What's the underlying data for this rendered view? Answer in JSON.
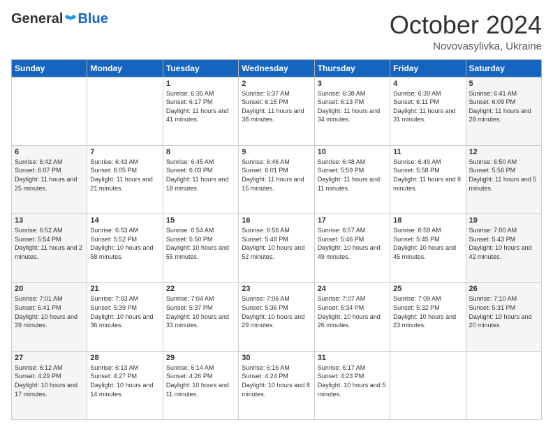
{
  "logo": {
    "general": "General",
    "blue": "Blue"
  },
  "header": {
    "month": "October 2024",
    "location": "Novovasylivka, Ukraine"
  },
  "weekdays": [
    "Sunday",
    "Monday",
    "Tuesday",
    "Wednesday",
    "Thursday",
    "Friday",
    "Saturday"
  ],
  "weeks": [
    [
      {
        "day": "",
        "sunrise": "",
        "sunset": "",
        "daylight": ""
      },
      {
        "day": "",
        "sunrise": "",
        "sunset": "",
        "daylight": ""
      },
      {
        "day": "1",
        "sunrise": "Sunrise: 6:35 AM",
        "sunset": "Sunset: 6:17 PM",
        "daylight": "Daylight: 11 hours and 41 minutes."
      },
      {
        "day": "2",
        "sunrise": "Sunrise: 6:37 AM",
        "sunset": "Sunset: 6:15 PM",
        "daylight": "Daylight: 11 hours and 38 minutes."
      },
      {
        "day": "3",
        "sunrise": "Sunrise: 6:38 AM",
        "sunset": "Sunset: 6:13 PM",
        "daylight": "Daylight: 11 hours and 34 minutes."
      },
      {
        "day": "4",
        "sunrise": "Sunrise: 6:39 AM",
        "sunset": "Sunset: 6:11 PM",
        "daylight": "Daylight: 11 hours and 31 minutes."
      },
      {
        "day": "5",
        "sunrise": "Sunrise: 6:41 AM",
        "sunset": "Sunset: 6:09 PM",
        "daylight": "Daylight: 11 hours and 28 minutes."
      }
    ],
    [
      {
        "day": "6",
        "sunrise": "Sunrise: 6:42 AM",
        "sunset": "Sunset: 6:07 PM",
        "daylight": "Daylight: 11 hours and 25 minutes."
      },
      {
        "day": "7",
        "sunrise": "Sunrise: 6:43 AM",
        "sunset": "Sunset: 6:05 PM",
        "daylight": "Daylight: 11 hours and 21 minutes."
      },
      {
        "day": "8",
        "sunrise": "Sunrise: 6:45 AM",
        "sunset": "Sunset: 6:03 PM",
        "daylight": "Daylight: 11 hours and 18 minutes."
      },
      {
        "day": "9",
        "sunrise": "Sunrise: 6:46 AM",
        "sunset": "Sunset: 6:01 PM",
        "daylight": "Daylight: 11 hours and 15 minutes."
      },
      {
        "day": "10",
        "sunrise": "Sunrise: 6:48 AM",
        "sunset": "Sunset: 5:59 PM",
        "daylight": "Daylight: 11 hours and 11 minutes."
      },
      {
        "day": "11",
        "sunrise": "Sunrise: 6:49 AM",
        "sunset": "Sunset: 5:58 PM",
        "daylight": "Daylight: 11 hours and 8 minutes."
      },
      {
        "day": "12",
        "sunrise": "Sunrise: 6:50 AM",
        "sunset": "Sunset: 5:56 PM",
        "daylight": "Daylight: 11 hours and 5 minutes."
      }
    ],
    [
      {
        "day": "13",
        "sunrise": "Sunrise: 6:52 AM",
        "sunset": "Sunset: 5:54 PM",
        "daylight": "Daylight: 11 hours and 2 minutes."
      },
      {
        "day": "14",
        "sunrise": "Sunrise: 6:53 AM",
        "sunset": "Sunset: 5:52 PM",
        "daylight": "Daylight: 10 hours and 58 minutes."
      },
      {
        "day": "15",
        "sunrise": "Sunrise: 6:54 AM",
        "sunset": "Sunset: 5:50 PM",
        "daylight": "Daylight: 10 hours and 55 minutes."
      },
      {
        "day": "16",
        "sunrise": "Sunrise: 6:56 AM",
        "sunset": "Sunset: 5:48 PM",
        "daylight": "Daylight: 10 hours and 52 minutes."
      },
      {
        "day": "17",
        "sunrise": "Sunrise: 6:57 AM",
        "sunset": "Sunset: 5:46 PM",
        "daylight": "Daylight: 10 hours and 49 minutes."
      },
      {
        "day": "18",
        "sunrise": "Sunrise: 6:59 AM",
        "sunset": "Sunset: 5:45 PM",
        "daylight": "Daylight: 10 hours and 45 minutes."
      },
      {
        "day": "19",
        "sunrise": "Sunrise: 7:00 AM",
        "sunset": "Sunset: 5:43 PM",
        "daylight": "Daylight: 10 hours and 42 minutes."
      }
    ],
    [
      {
        "day": "20",
        "sunrise": "Sunrise: 7:01 AM",
        "sunset": "Sunset: 5:41 PM",
        "daylight": "Daylight: 10 hours and 39 minutes."
      },
      {
        "day": "21",
        "sunrise": "Sunrise: 7:03 AM",
        "sunset": "Sunset: 5:39 PM",
        "daylight": "Daylight: 10 hours and 36 minutes."
      },
      {
        "day": "22",
        "sunrise": "Sunrise: 7:04 AM",
        "sunset": "Sunset: 5:37 PM",
        "daylight": "Daylight: 10 hours and 33 minutes."
      },
      {
        "day": "23",
        "sunrise": "Sunrise: 7:06 AM",
        "sunset": "Sunset: 5:36 PM",
        "daylight": "Daylight: 10 hours and 29 minutes."
      },
      {
        "day": "24",
        "sunrise": "Sunrise: 7:07 AM",
        "sunset": "Sunset: 5:34 PM",
        "daylight": "Daylight: 10 hours and 26 minutes."
      },
      {
        "day": "25",
        "sunrise": "Sunrise: 7:09 AM",
        "sunset": "Sunset: 5:32 PM",
        "daylight": "Daylight: 10 hours and 23 minutes."
      },
      {
        "day": "26",
        "sunrise": "Sunrise: 7:10 AM",
        "sunset": "Sunset: 5:31 PM",
        "daylight": "Daylight: 10 hours and 20 minutes."
      }
    ],
    [
      {
        "day": "27",
        "sunrise": "Sunrise: 6:12 AM",
        "sunset": "Sunset: 4:29 PM",
        "daylight": "Daylight: 10 hours and 17 minutes."
      },
      {
        "day": "28",
        "sunrise": "Sunrise: 6:13 AM",
        "sunset": "Sunset: 4:27 PM",
        "daylight": "Daylight: 10 hours and 14 minutes."
      },
      {
        "day": "29",
        "sunrise": "Sunrise: 6:14 AM",
        "sunset": "Sunset: 4:26 PM",
        "daylight": "Daylight: 10 hours and 11 minutes."
      },
      {
        "day": "30",
        "sunrise": "Sunrise: 6:16 AM",
        "sunset": "Sunset: 4:24 PM",
        "daylight": "Daylight: 10 hours and 8 minutes."
      },
      {
        "day": "31",
        "sunrise": "Sunrise: 6:17 AM",
        "sunset": "Sunset: 4:23 PM",
        "daylight": "Daylight: 10 hours and 5 minutes."
      },
      {
        "day": "",
        "sunrise": "",
        "sunset": "",
        "daylight": ""
      },
      {
        "day": "",
        "sunrise": "",
        "sunset": "",
        "daylight": ""
      }
    ]
  ]
}
